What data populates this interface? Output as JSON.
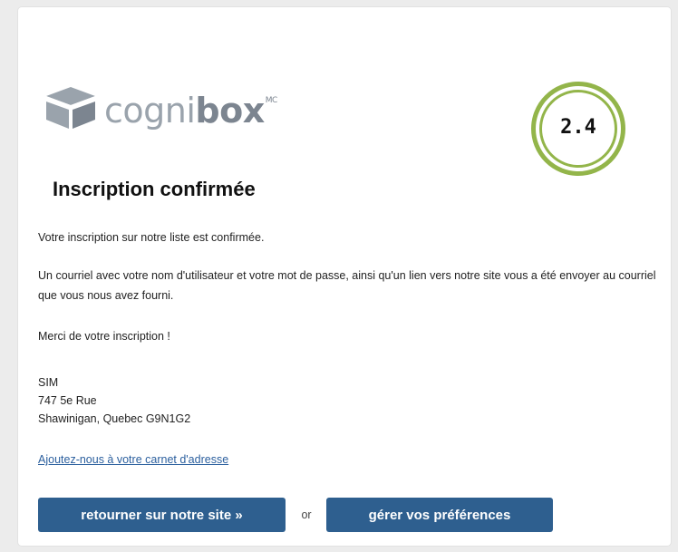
{
  "brand": {
    "logo_cogni": "cogni",
    "logo_box": "box",
    "logo_mark": "MC",
    "logo_icon": "cube-logo-icon",
    "colors": {
      "logo_grey": "#9aa3ac",
      "logo_dark": "#7c8590"
    }
  },
  "badge": {
    "text": "2.4",
    "color": "#93b54a"
  },
  "content": {
    "title": "Inscription confirmée",
    "paragraph_1": "Votre inscription sur notre liste est confirmée.",
    "paragraph_2": "Un courriel avec votre nom d'utilisateur et votre mot de passe, ainsi qu'un lien vers notre site vous a été envoyer au courriel que vous nous avez fourni.",
    "paragraph_3": "Merci de votre inscription !",
    "address": {
      "line_1": "SIM",
      "line_2": "747 5e Rue",
      "line_3": "Shawinigan, Quebec G9N1G2"
    },
    "address_book_link": "Ajoutez-nous à votre carnet d'adresse"
  },
  "actions": {
    "back_to_site_label": "retourner sur notre site »",
    "separator": "or",
    "preferences_label": "gérer vos préférences",
    "button_color": "#2e5f8f",
    "link_color": "#2b5f9e"
  }
}
